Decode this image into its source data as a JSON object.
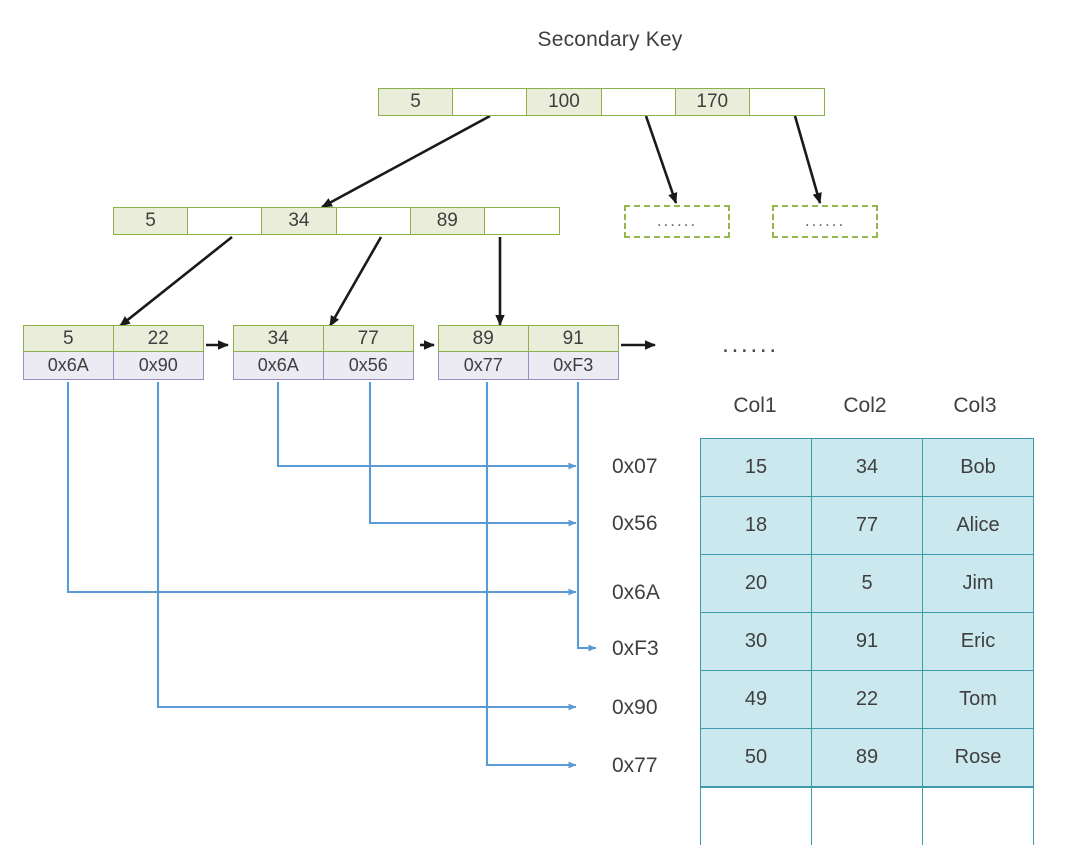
{
  "title": "Secondary Key",
  "colors": {
    "index_fill": "#e9edda",
    "index_border": "#8cb04a",
    "pointer_fill": "#eceaf2",
    "pointer_border": "#9b8fc4",
    "table_fill": "#cce8ef",
    "table_border": "#3f9aad",
    "connector_blue": "#5b9bd5",
    "arrow_black": "#1a1a1a"
  },
  "tree": {
    "root": {
      "cells": [
        {
          "text": "5",
          "key": true
        },
        {
          "text": "",
          "key": false
        },
        {
          "text": "100",
          "key": true
        },
        {
          "text": "",
          "key": false
        },
        {
          "text": "170",
          "key": true
        },
        {
          "text": "",
          "key": false
        }
      ]
    },
    "internal": {
      "cells": [
        {
          "text": "5",
          "key": true
        },
        {
          "text": "",
          "key": false
        },
        {
          "text": "34",
          "key": true
        },
        {
          "text": "",
          "key": false
        },
        {
          "text": "89",
          "key": true
        },
        {
          "text": "",
          "key": false
        }
      ]
    },
    "leaves": [
      {
        "keys": [
          "5",
          "22"
        ],
        "pointers": [
          "0x6A",
          "0x90"
        ]
      },
      {
        "keys": [
          "34",
          "77"
        ],
        "pointers": [
          "0x6A",
          "0x56"
        ]
      },
      {
        "keys": [
          "89",
          "91"
        ],
        "pointers": [
          "0x77",
          "0xF3"
        ]
      }
    ],
    "placeholders": [
      {
        "text": "......"
      },
      {
        "text": "......"
      }
    ],
    "leaf_continuation": "......"
  },
  "addresses": [
    {
      "label": "0x07"
    },
    {
      "label": "0x56"
    },
    {
      "label": "0x6A"
    },
    {
      "label": "0xF3"
    },
    {
      "label": "0x90"
    },
    {
      "label": "0x77"
    }
  ],
  "table": {
    "headers": [
      "Col1",
      "Col2",
      "Col3"
    ],
    "rows": [
      [
        "15",
        "34",
        "Bob"
      ],
      [
        "18",
        "77",
        "Alice"
      ],
      [
        "20",
        "5",
        "Jim"
      ],
      [
        "30",
        "91",
        "Eric"
      ],
      [
        "49",
        "22",
        "Tom"
      ],
      [
        "50",
        "89",
        "Rose"
      ]
    ]
  }
}
